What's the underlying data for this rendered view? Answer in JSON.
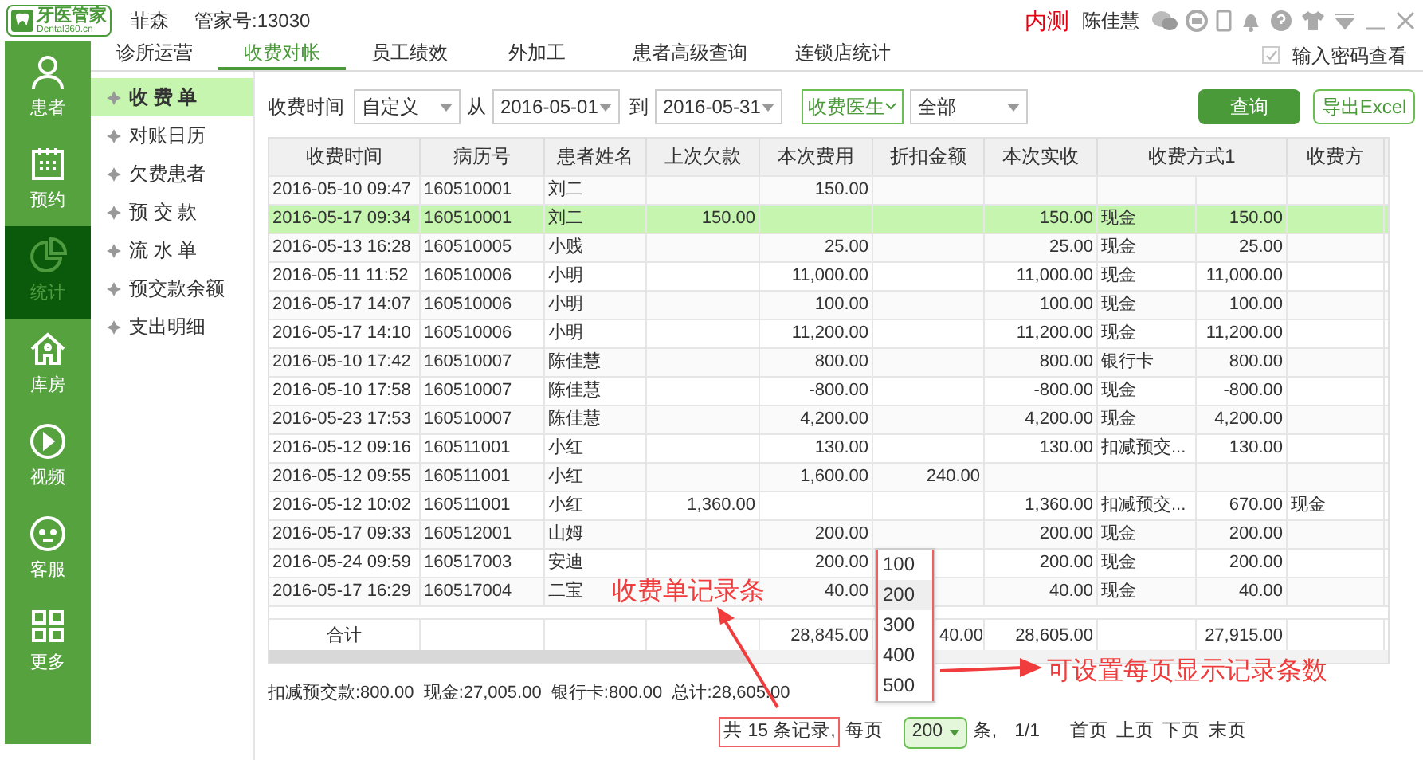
{
  "app": {
    "logo_title": "牙医管家",
    "logo_subtitle": "Dental360.cn",
    "clinic": "菲森",
    "account": "管家号:13030",
    "env_label": "内测",
    "user": "陈佳慧"
  },
  "sidebar": [
    {
      "kind": "person",
      "label": "患者",
      "selected": false
    },
    {
      "kind": "calendar",
      "label": "预约",
      "selected": false
    },
    {
      "kind": "pie",
      "label": "统计",
      "selected": true
    },
    {
      "kind": "house",
      "label": "库房",
      "selected": false
    },
    {
      "kind": "play",
      "label": "视频",
      "selected": false
    },
    {
      "kind": "face",
      "label": "客服",
      "selected": false
    },
    {
      "kind": "grid",
      "label": "更多",
      "selected": false
    }
  ],
  "tabs": [
    {
      "label": "诊所运营",
      "selected": false
    },
    {
      "label": "收费对帐",
      "selected": true
    },
    {
      "label": "员工绩效",
      "selected": false
    },
    {
      "label": "外加工",
      "selected": false
    },
    {
      "label": "患者高级查询",
      "selected": false
    },
    {
      "label": "连锁店统计",
      "selected": false
    }
  ],
  "password_view": {
    "label": "输入密码查看",
    "checked": true
  },
  "submenu": [
    {
      "label": "收 费 单",
      "selected": true
    },
    {
      "label": "对账日历",
      "selected": false
    },
    {
      "label": "欠费患者",
      "selected": false
    },
    {
      "label": "预 交 款",
      "selected": false
    },
    {
      "label": "流 水 单",
      "selected": false
    },
    {
      "label": "预交款余额",
      "selected": false
    },
    {
      "label": "支出明细",
      "selected": false
    }
  ],
  "filters": {
    "time_label": "收费时间",
    "time_mode": "自定义",
    "from_label": "从",
    "from_date": "2016-05-01",
    "to_label": "到",
    "to_date": "2016-05-31",
    "doctor_label": "收费医生",
    "doctor_value": "全部",
    "query_button": "查询",
    "export_button": "导出Excel"
  },
  "table": {
    "columns": [
      "收费时间",
      "病历号",
      "患者姓名",
      "上次欠款",
      "本次费用",
      "折扣金额",
      "本次实收",
      "收费方式1",
      "收费方"
    ],
    "rows": [
      {
        "cells": [
          "2016-05-10 09:47",
          "160510001",
          "刘二",
          "",
          "150.00",
          "",
          "",
          "",
          "",
          ""
        ],
        "selected": false
      },
      {
        "cells": [
          "2016-05-17 09:34",
          "160510001",
          "刘二",
          "150.00",
          "",
          "",
          "150.00",
          "现金",
          "150.00",
          ""
        ],
        "selected": true
      },
      {
        "cells": [
          "2016-05-13 16:28",
          "160510005",
          "小贱",
          "",
          "25.00",
          "",
          "25.00",
          "现金",
          "25.00",
          ""
        ],
        "selected": false
      },
      {
        "cells": [
          "2016-05-11 11:52",
          "160510006",
          "小明",
          "",
          "11,000.00",
          "",
          "11,000.00",
          "现金",
          "11,000.00",
          ""
        ],
        "selected": false
      },
      {
        "cells": [
          "2016-05-17 14:07",
          "160510006",
          "小明",
          "",
          "100.00",
          "",
          "100.00",
          "现金",
          "100.00",
          ""
        ],
        "selected": false
      },
      {
        "cells": [
          "2016-05-17 14:10",
          "160510006",
          "小明",
          "",
          "11,200.00",
          "",
          "11,200.00",
          "现金",
          "11,200.00",
          ""
        ],
        "selected": false
      },
      {
        "cells": [
          "2016-05-10 17:42",
          "160510007",
          "陈佳慧",
          "",
          "800.00",
          "",
          "800.00",
          "银行卡",
          "800.00",
          ""
        ],
        "selected": false
      },
      {
        "cells": [
          "2016-05-10 17:58",
          "160510007",
          "陈佳慧",
          "",
          "-800.00",
          "",
          "-800.00",
          "现金",
          "-800.00",
          ""
        ],
        "selected": false
      },
      {
        "cells": [
          "2016-05-23 17:53",
          "160510007",
          "陈佳慧",
          "",
          "4,200.00",
          "",
          "4,200.00",
          "现金",
          "4,200.00",
          ""
        ],
        "selected": false
      },
      {
        "cells": [
          "2016-05-12 09:16",
          "160511001",
          "小红",
          "",
          "130.00",
          "",
          "130.00",
          "扣减预交...",
          "130.00",
          ""
        ],
        "selected": false
      },
      {
        "cells": [
          "2016-05-12 09:55",
          "160511001",
          "小红",
          "",
          "1,600.00",
          "240.00",
          "",
          "",
          "",
          ""
        ],
        "selected": false
      },
      {
        "cells": [
          "2016-05-12 10:02",
          "160511001",
          "小红",
          "1,360.00",
          "",
          "",
          "1,360.00",
          "扣减预交...",
          "670.00",
          "现金"
        ],
        "selected": false
      },
      {
        "cells": [
          "2016-05-17 09:33",
          "160512001",
          "山姆",
          "",
          "200.00",
          "",
          "200.00",
          "现金",
          "200.00",
          ""
        ],
        "selected": false
      },
      {
        "cells": [
          "2016-05-24 09:59",
          "160517003",
          "安迪",
          "",
          "200.00",
          "",
          "200.00",
          "现金",
          "200.00",
          ""
        ],
        "selected": false
      },
      {
        "cells": [
          "2016-05-17 16:29",
          "160517004",
          "二宝",
          "",
          "40.00",
          "",
          "40.00",
          "现金",
          "40.00",
          ""
        ],
        "selected": false
      }
    ],
    "total": {
      "label": "合计",
      "fee": "28,845.00",
      "discount": "40.00",
      "paid": "28,605.00",
      "amount1": "27,915.00"
    }
  },
  "summary": "扣减预交款:800.00  现金:27,005.00  银行卡:800.00  总计:28,605.00",
  "pagination": {
    "record_count": "共 15 条记录,",
    "per_page_label": "每页",
    "per_page": "200",
    "unit": "条,",
    "page": "1/1",
    "links": [
      "首页",
      "上页",
      "下页",
      "末页"
    ]
  },
  "page_size_menu": {
    "options": [
      {
        "label": "100",
        "selected": false
      },
      {
        "label": "200",
        "selected": true
      },
      {
        "label": "300",
        "selected": false
      },
      {
        "label": "400",
        "selected": false
      },
      {
        "label": "500",
        "selected": false
      }
    ]
  },
  "annotations": {
    "records_note": "收费单记录条",
    "page_size_note": "可设置每页显示记录条数"
  }
}
